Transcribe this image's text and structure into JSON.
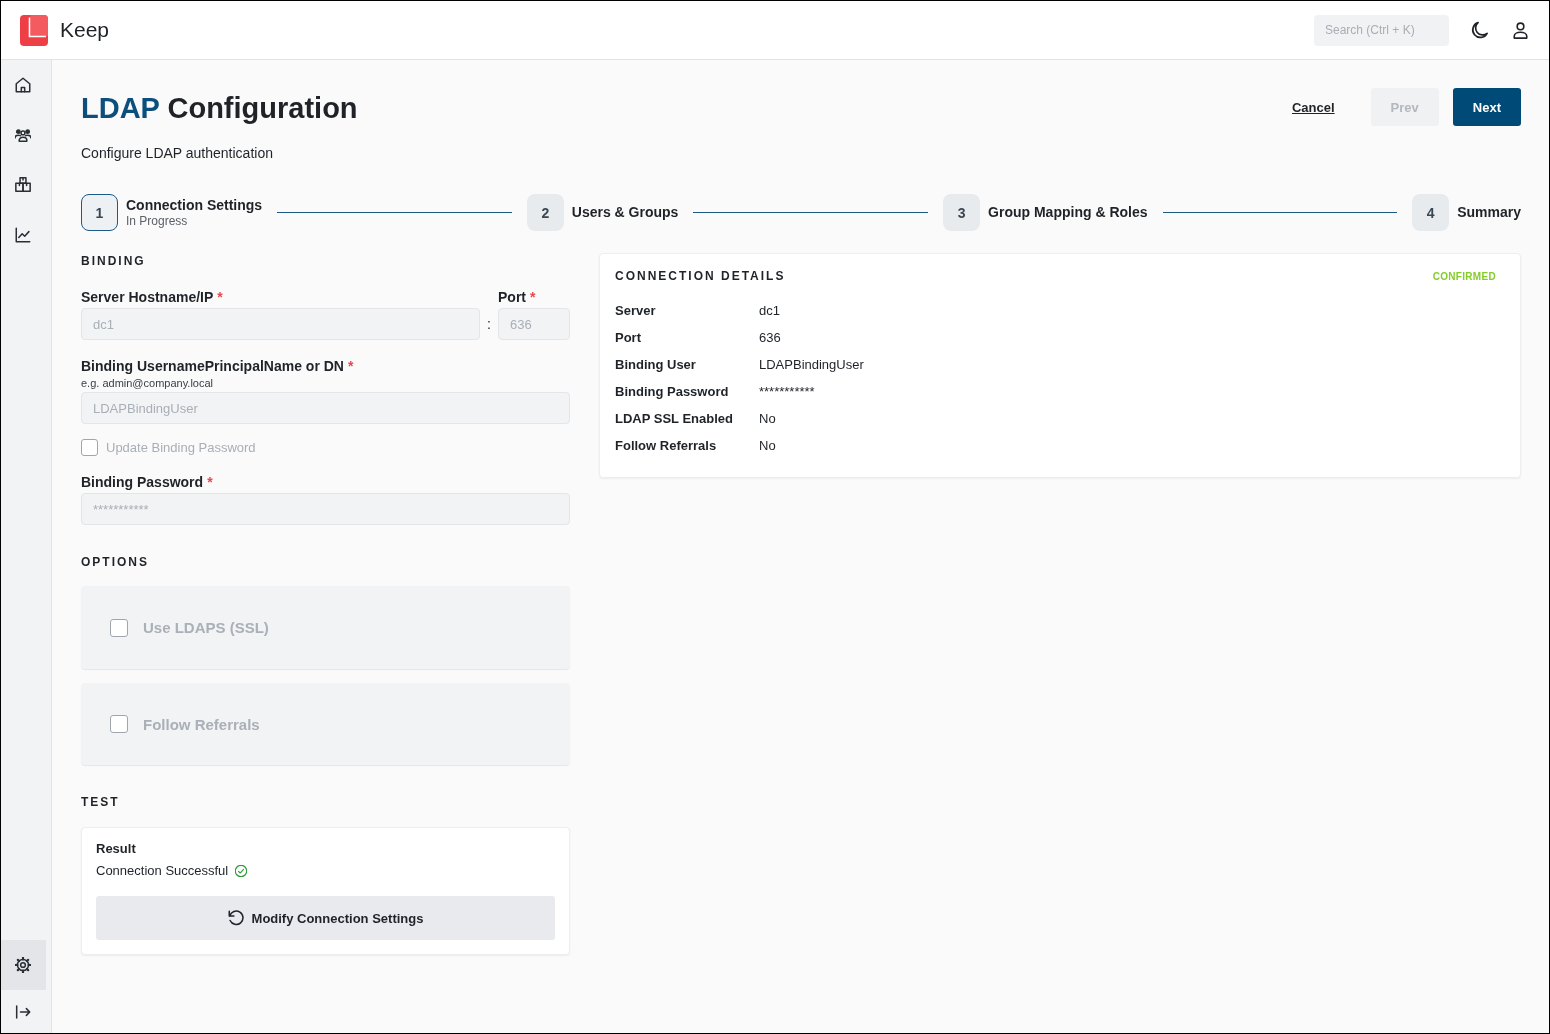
{
  "header": {
    "app_name": "Keep",
    "search": {
      "placeholder": "Search (Ctrl + K)"
    }
  },
  "sidebar": {
    "items": [
      {
        "kind": "home",
        "selected": false
      },
      {
        "kind": "users",
        "selected": false
      },
      {
        "kind": "boxes",
        "selected": false
      },
      {
        "kind": "chart",
        "selected": false
      }
    ],
    "bottom_items": [
      {
        "kind": "settings",
        "selected": true
      },
      {
        "kind": "exit",
        "selected": false
      }
    ]
  },
  "page": {
    "title": {
      "accent": "LDAP",
      "rest": "Configuration"
    },
    "subtitle": "Configure LDAP authentication",
    "actions": {
      "cancel": "Cancel",
      "prev": {
        "label": "Prev",
        "disabled": true
      },
      "next": {
        "label": "Next",
        "disabled": false
      }
    }
  },
  "steps": [
    {
      "number": "1",
      "label": "Connection Settings",
      "status": "In Progress",
      "selected": true
    },
    {
      "number": "2",
      "label": "Users & Groups",
      "selected": false
    },
    {
      "number": "3",
      "label": "Group Mapping & Roles",
      "selected": false
    },
    {
      "number": "4",
      "label": "Summary",
      "selected": false
    }
  ],
  "binding": {
    "heading": "BINDING",
    "hostname": {
      "label": "Server Hostname/IP",
      "required_mark": "*",
      "value": "dc1",
      "disabled": true
    },
    "separator": ":",
    "port": {
      "label": "Port",
      "required_mark": "*",
      "value": "636",
      "disabled": true
    },
    "username": {
      "label": "Binding UsernamePrincipalName or DN",
      "required_mark": "*",
      "hint": "e.g. admin@company.local",
      "value": "LDAPBindingUser",
      "disabled": true
    },
    "update_password": {
      "label": "Update Binding Password",
      "checked": false,
      "disabled": true
    },
    "password": {
      "label": "Binding Password",
      "required_mark": "*",
      "value": "***********",
      "disabled": true
    }
  },
  "options": {
    "heading": "OPTIONS",
    "items": [
      {
        "label": "Use LDAPS (SSL)",
        "checked": false,
        "disabled": true
      },
      {
        "label": "Follow Referrals",
        "checked": false,
        "disabled": true
      }
    ]
  },
  "test": {
    "heading": "TEST",
    "result_label": "Result",
    "result": "Connection Successful",
    "success": true,
    "button": "Modify Connection Settings"
  },
  "connection_details": {
    "heading": "CONNECTION DETAILS",
    "status": "CONFIRMED",
    "rows": [
      {
        "label": "Server",
        "value": "dc1"
      },
      {
        "label": "Port",
        "value": "636"
      },
      {
        "label": "Binding User",
        "value": "LDAPBindingUser"
      },
      {
        "label": "Binding Password",
        "value": "***********"
      },
      {
        "label": "LDAP SSL Enabled",
        "value": "No"
      },
      {
        "label": "Follow Referrals",
        "value": "No"
      }
    ]
  }
}
